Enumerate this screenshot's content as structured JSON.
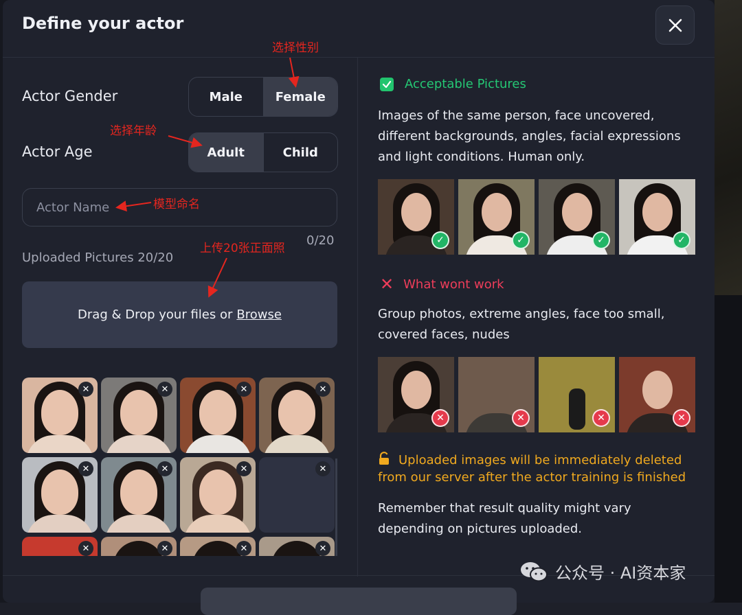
{
  "modal": {
    "title": "Define your actor",
    "close_icon": "close-icon"
  },
  "gender": {
    "label": "Actor Gender",
    "options": [
      "Male",
      "Female"
    ],
    "selected": "Female"
  },
  "age": {
    "label": "Actor Age",
    "options": [
      "Adult",
      "Child"
    ],
    "selected": "Adult"
  },
  "name_field": {
    "placeholder": "Actor Name",
    "counter": "0/20"
  },
  "upload": {
    "label": "Uploaded Pictures 20/20",
    "drop_text": "Drag & Drop your files or",
    "browse": "Browse"
  },
  "acceptable": {
    "title": "Acceptable Pictures",
    "text_lines": [
      "Images of the same person, face uncovered,",
      "different backgrounds, angles, facial expressions",
      "and light conditions. Human only."
    ]
  },
  "wont_work": {
    "title": "What wont work",
    "text_lines": [
      "Group photos, extreme angles, face too small,",
      "covered faces, nudes"
    ]
  },
  "privacy_note": {
    "lines": [
      "Uploaded images will be immediately deleted",
      "from our server after the actor training is finished"
    ]
  },
  "quality_note": {
    "lines": [
      "Remember that result quality might vary",
      "depending on pictures uploaded."
    ]
  },
  "annotations": {
    "gender": "选择性别",
    "age": "选择年龄",
    "name": "模型命名",
    "upload": "上传20张正面照"
  },
  "watermark": {
    "text": "公众号 · AI资本家"
  },
  "colors": {
    "accent_green": "#22c46e",
    "accent_red": "#ee3d5a",
    "accent_orange": "#f0a91f",
    "annotation_red": "#e5261f",
    "modal_bg": "#1f222d"
  }
}
